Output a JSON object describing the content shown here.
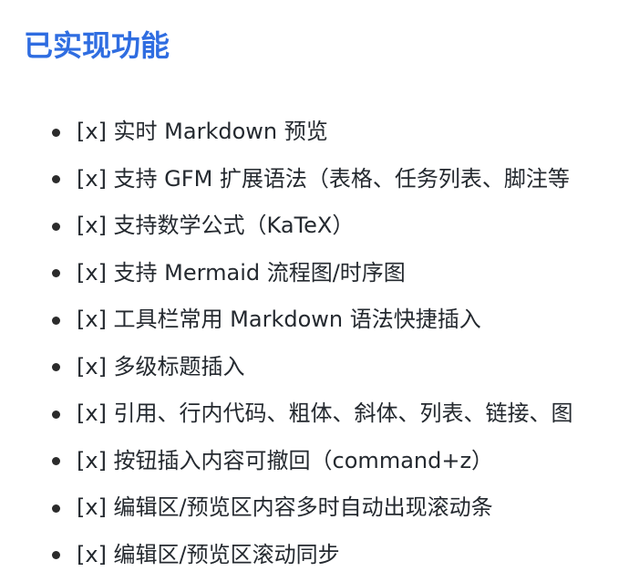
{
  "heading": "已实现功能",
  "colors": {
    "heading": "#2f6de1",
    "text": "#24292f",
    "bullet": "#2b2b2b"
  },
  "features": [
    "[x] 实时 Markdown 预览",
    "[x] 支持 GFM 扩展语法（表格、任务列表、脚注等",
    "[x] 支持数学公式（KaTeX）",
    "[x] 支持 Mermaid 流程图/时序图",
    "[x] 工具栏常用 Markdown 语法快捷插入",
    "[x] 多级标题插入",
    "[x] 引用、行内代码、粗体、斜体、列表、链接、图",
    "[x] 按钮插入内容可撤回（command+z）",
    "[x] 编辑区/预览区内容多时自动出现滚动条",
    "[x] 编辑区/预览区滚动同步"
  ]
}
